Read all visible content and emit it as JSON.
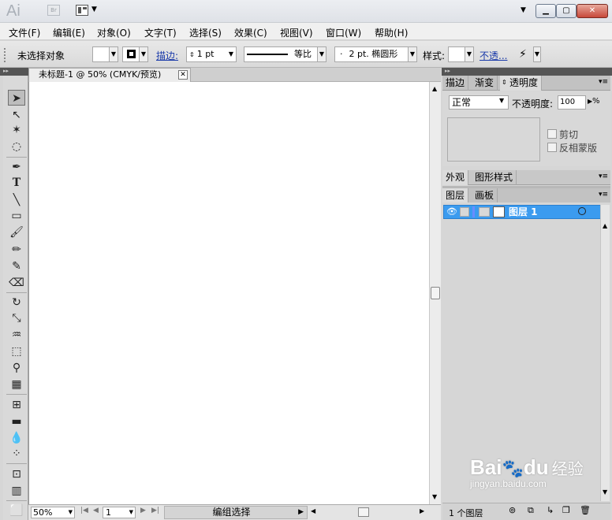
{
  "app": {
    "logo": "Ai",
    "br_label": "Br"
  },
  "menu": [
    "文件(F)",
    "编辑(E)",
    "对象(O)",
    "文字(T)",
    "选择(S)",
    "效果(C)",
    "视图(V)",
    "窗口(W)",
    "帮助(H)"
  ],
  "control": {
    "no_selection": "未选择对象",
    "stroke_label": "描边:",
    "stroke_weight": "1 pt",
    "profile_label": "等比",
    "brush_label": "2 pt. 椭圆形",
    "style_label": "样式:",
    "opacity_link": "不透..."
  },
  "document": {
    "tab_title": "未标题-1 @ 50% (CMYK/预览)",
    "zoom": "50%",
    "artboard": "1",
    "status": "编组选择"
  },
  "panels": {
    "top_tabs": [
      "描边",
      "渐变",
      "透明度"
    ],
    "blend_mode": "正常",
    "opacity_label": "不透明度:",
    "opacity_value": "100",
    "opacity_unit": "%",
    "clip_label": "剪切",
    "invert_label": "反相蒙版",
    "mid_tabs": [
      "外观",
      "图形样式"
    ],
    "layer_tabs": [
      "图层",
      "画板"
    ],
    "layer_name": "图层 1",
    "layers_count": "1 个图层"
  },
  "watermark": {
    "brand": "Bai",
    "brand2": "du",
    "jingyan": "经验",
    "url": "jingyan.baidu.com"
  },
  "colors": {
    "accent": "#3b9bef"
  }
}
